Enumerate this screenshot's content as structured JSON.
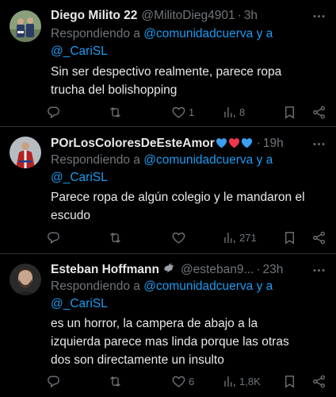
{
  "reply_prefix": "Respondiendo a",
  "tweets": [
    {
      "name": "Diego Milito 22",
      "handle": "@MilitoDieg4901",
      "separator": "·",
      "time": "3h",
      "mentions": [
        "@comunidadcuerva",
        "y a",
        "@_CariSL"
      ],
      "lines": [
        "Sin ser despectivo realmente, parece ropa",
        "trucha del bolishopping"
      ],
      "replies": "",
      "retweets": "",
      "likes": "1",
      "views": "8"
    },
    {
      "name": "POrLosColoresDeEsteAmor",
      "handle": "",
      "separator": "·",
      "time": "19h",
      "mentions": [
        "@comunidadcuerva",
        "y a",
        "@_CariSL"
      ],
      "lines": [
        "Parece ropa de algún colegio y le mandaron el",
        "escudo"
      ],
      "replies": "",
      "retweets": "",
      "likes": "",
      "views": "271"
    },
    {
      "name": "Esteban Hoffmann",
      "handle": "@esteban9...",
      "separator": "·",
      "time": "23h",
      "mentions": [
        "@comunidadcuerva",
        "y a",
        "@_CariSL"
      ],
      "lines": [
        "es un horror, la campera de abajo a la",
        "izquierda parece mas linda porque las otras",
        "dos son directamente un insulto"
      ],
      "replies": "",
      "retweets": "",
      "likes": "6",
      "views": "1,8K"
    }
  ],
  "colors": {
    "background": "#000000",
    "text": "#e7e9ea",
    "secondary": "#71767b",
    "accent": "#1d9bf0",
    "divider": "#2f3336"
  },
  "icons": [
    "more-icon",
    "reply-icon",
    "retweet-icon",
    "like-icon",
    "views-icon",
    "bookmark-icon",
    "share-icon",
    "blue-heart-icon",
    "red-heart-icon",
    "pigeon-icon"
  ]
}
